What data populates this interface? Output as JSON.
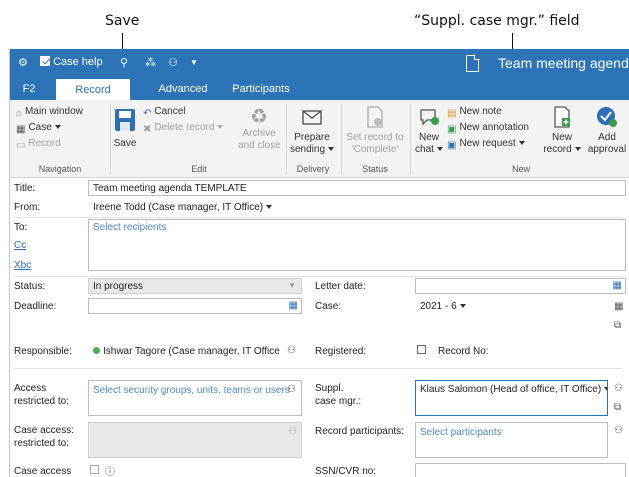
{
  "callouts": {
    "save": "Save",
    "suppl_field": "“Suppl. case mgr.” field"
  },
  "titlebar": {
    "app_name": "Case help",
    "window_title": "Team meeting agenda"
  },
  "tabs": [
    {
      "label": "F2",
      "active": false
    },
    {
      "label": "Record",
      "active": true
    },
    {
      "label": "Advanced",
      "active": false
    },
    {
      "label": "Participants",
      "active": false
    }
  ],
  "ribbon": {
    "navigation": {
      "main_window": "Main window",
      "case": "Case",
      "record": "Record",
      "label": "Navigation"
    },
    "edit": {
      "save": "Save",
      "cancel": "Cancel",
      "delete_record": "Delete record",
      "archive_line1": "Archive",
      "archive_line2": "and close",
      "label": "Edit"
    },
    "delivery": {
      "prepare_line1": "Prepare",
      "prepare_line2": "sending",
      "label": "Delivery"
    },
    "status": {
      "set_line1": "Set record to",
      "set_line2": "'Complete'",
      "label": "Status"
    },
    "new": {
      "new_chat_line1": "New",
      "new_chat_line2": "chat",
      "new_note": "New note",
      "new_annotation": "New annotation",
      "new_request": "New request",
      "new_record_line1": "New",
      "new_record_line2": "record",
      "add_approval_line1": "Add",
      "add_approval_line2": "approval",
      "label": "New"
    }
  },
  "form": {
    "title_label": "Title:",
    "title_value": "Team meeting agenda TEMPLATE",
    "from_label": "From:",
    "from_value": "Ireene Todd (Case manager, IT Office)",
    "to_label": "To:",
    "to_placeholder": "Select recipients",
    "cc_label": "Cc",
    "xbc_label": "Xbc",
    "status_label": "Status:",
    "status_value": "In progress",
    "letter_date_label": "Letter date:",
    "deadline_label": "Deadline:",
    "case_label": "Case:",
    "case_value": "2021 - 6",
    "responsible_label": "Responsible:",
    "responsible_value": "Ishwar Tagore (Case manager, IT Office",
    "registered_label": "Registered:",
    "record_no_label": "Record No:",
    "access_label_1": "Access",
    "access_label_2": "restricted to:",
    "access_placeholder": "Select security groups, units, teams or users",
    "suppl_label_1": "Suppl.",
    "suppl_label_2": "case mgr.:",
    "suppl_value": "Klaus Salomon (Head of office, IT Office)",
    "case_access_label_1": "Case access:",
    "case_access_label_2": "restricted to:",
    "record_participants_label": "Record participants:",
    "record_participants_placeholder": "Select participants",
    "case_access_bottom_label": "Case access",
    "ssn_label": "SSN/CVR no:"
  }
}
